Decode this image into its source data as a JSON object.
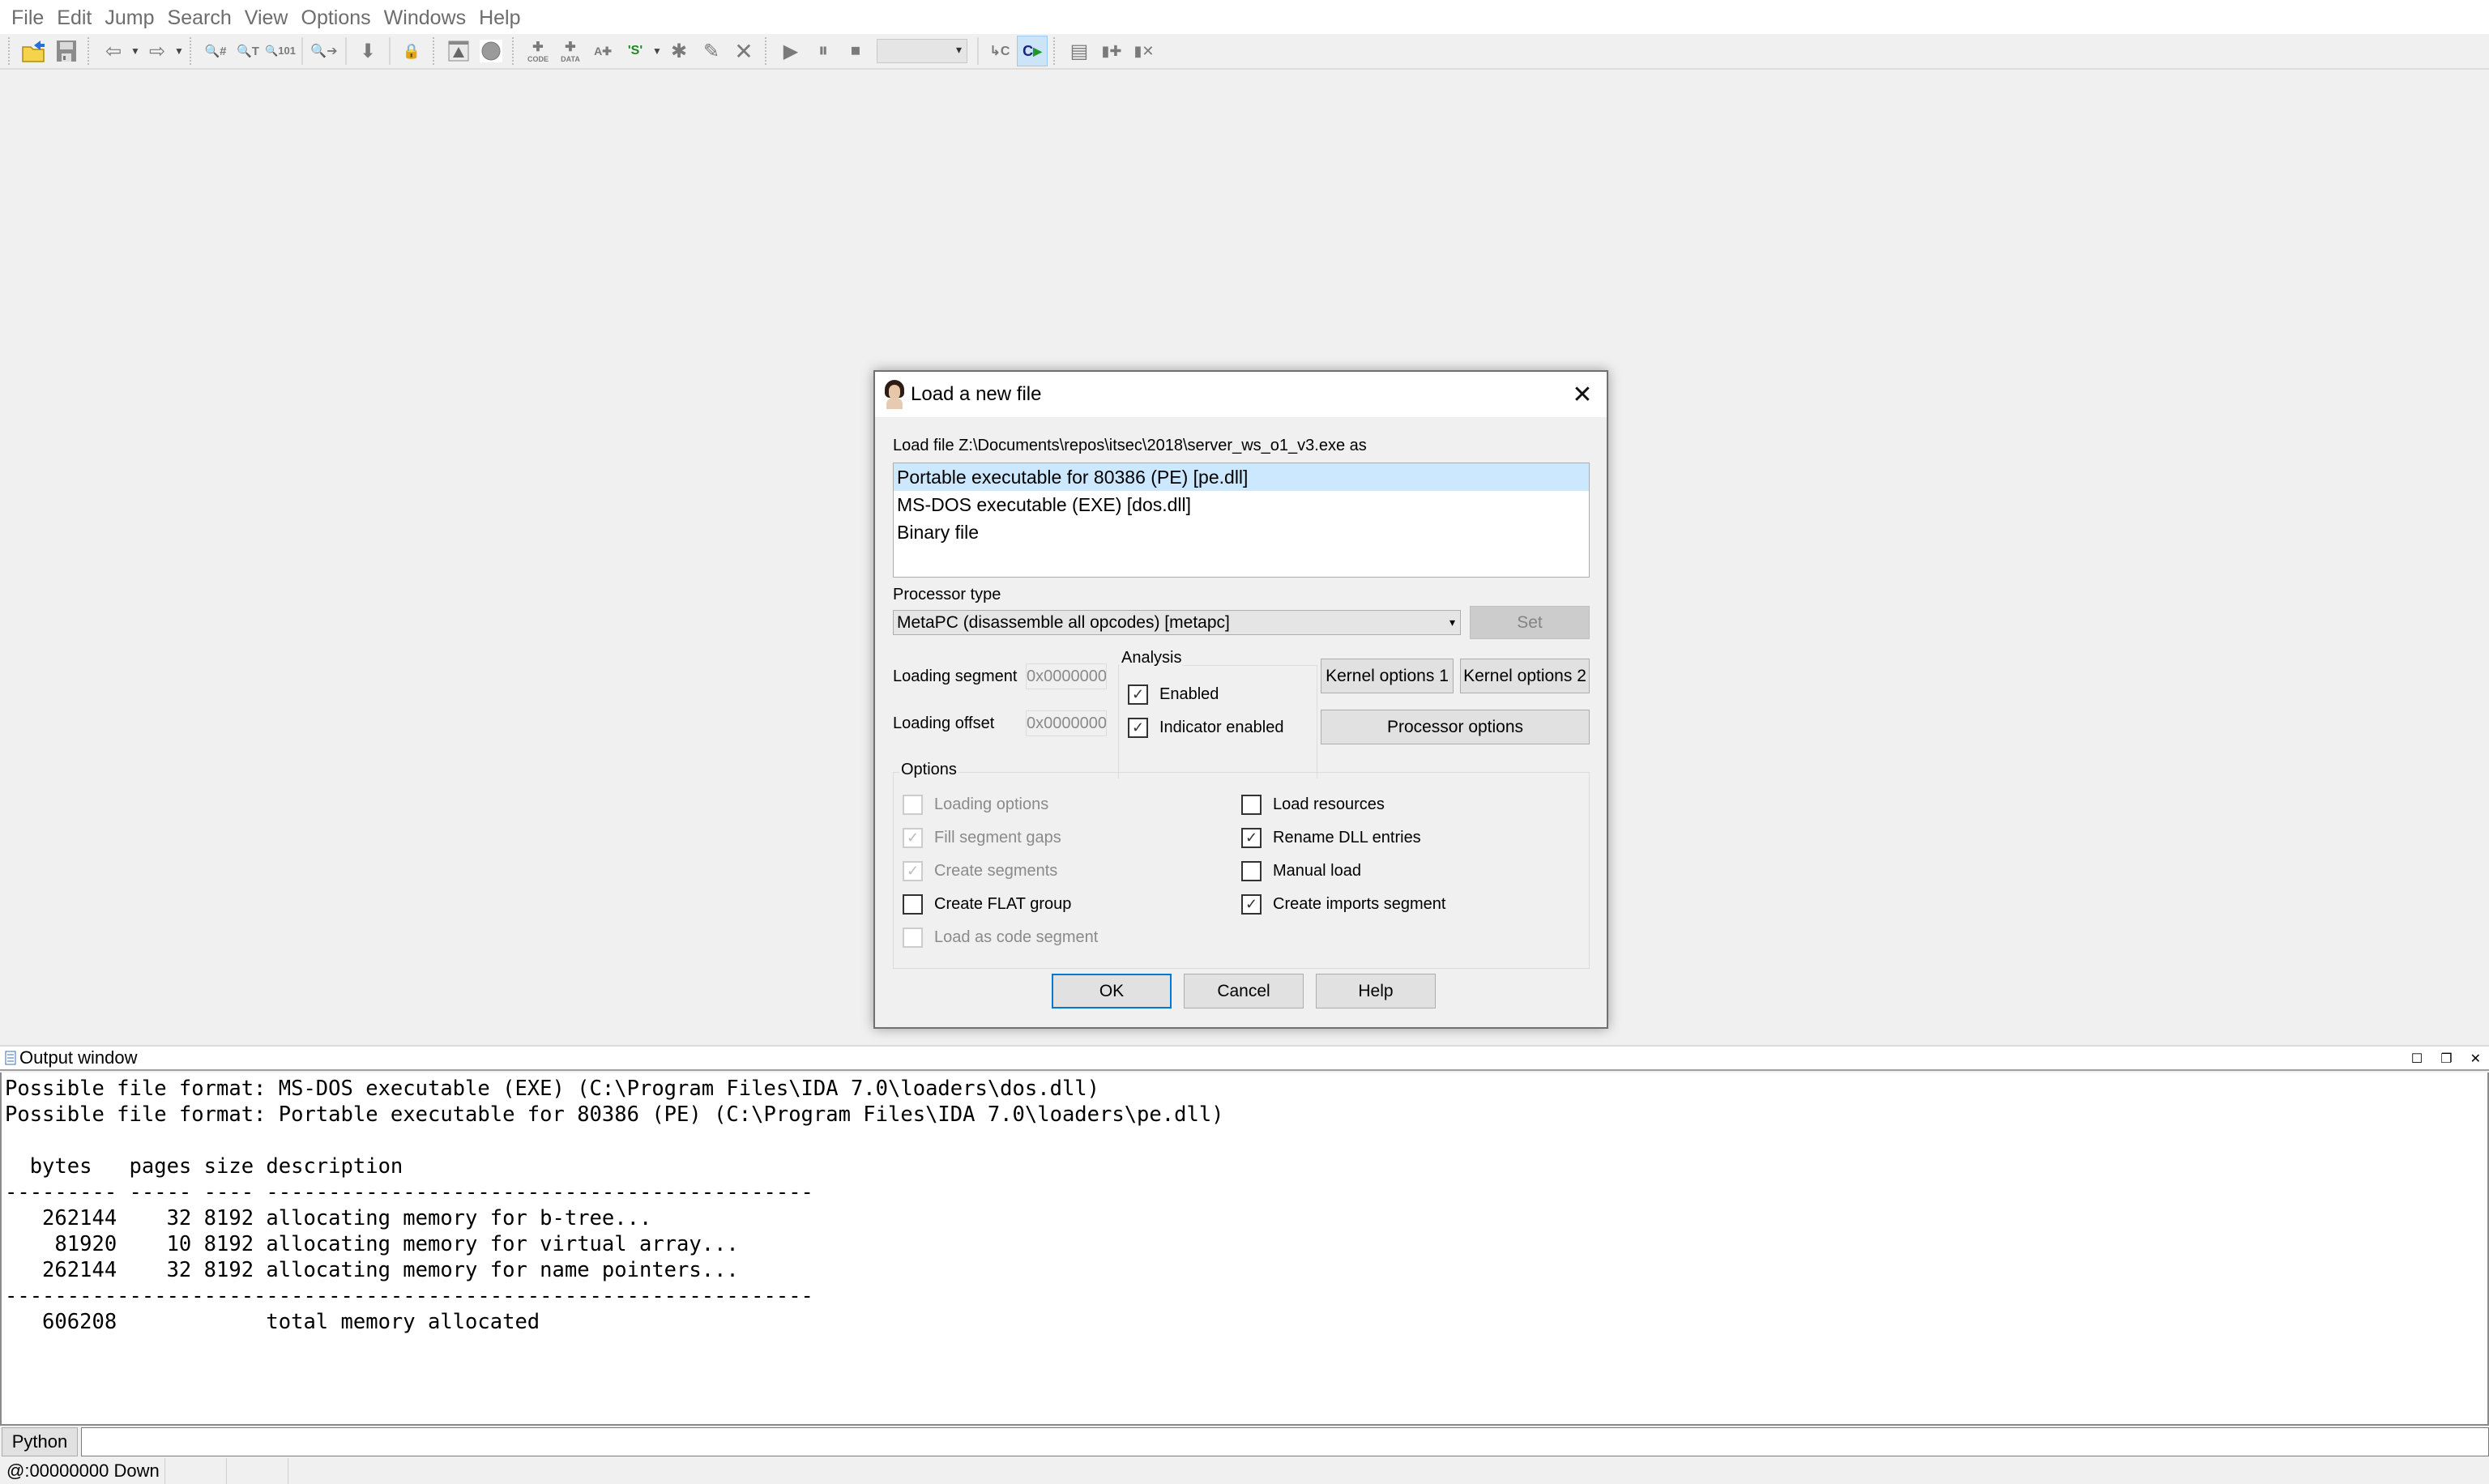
{
  "menu": [
    "File",
    "Edit",
    "Jump",
    "Search",
    "View",
    "Options",
    "Windows",
    "Help"
  ],
  "toolbar": {
    "groups": [
      [
        "open-file",
        "save-database"
      ],
      [
        "back",
        "forward"
      ],
      [
        "search-binary",
        "search-text",
        "search-immediate",
        "search-next",
        "jump-down",
        "lock"
      ],
      [
        "warning-window",
        "breakpoint-circle"
      ],
      [
        "create-code",
        "create-data",
        "create-ascii",
        "create-struct",
        "create-function",
        "edit-function",
        "undefine"
      ],
      [
        "run",
        "pause",
        "stop"
      ],
      [
        "step-into",
        "debugger-active"
      ],
      [
        "manage-segments",
        "add-segment",
        "delete-segment"
      ]
    ],
    "debugger_select_value": ""
  },
  "dialog": {
    "title": "Load a new file",
    "load_file_label": "Load file Z:\\Documents\\repos\\itsec\\2018\\server_ws_o1_v3.exe as",
    "file_types": [
      {
        "label": "Portable executable for 80386 (PE) [pe.dll]",
        "selected": true
      },
      {
        "label": "MS-DOS executable (EXE) [dos.dll]",
        "selected": false
      },
      {
        "label": "Binary file",
        "selected": false
      }
    ],
    "processor_type_label": "Processor type",
    "processor_type_value": "MetaPC (disassemble all opcodes) [metapc]",
    "set_button": "Set",
    "loading_segment_label": "Loading segment",
    "loading_segment_value": "0x00000000",
    "loading_offset_label": "Loading offset",
    "loading_offset_value": "0x00000000",
    "analysis": {
      "title": "Analysis",
      "enabled": {
        "label": "Enabled",
        "checked": true
      },
      "indicator_enabled": {
        "label": "Indicator enabled",
        "checked": true
      }
    },
    "kernel_options_1": "Kernel options 1",
    "kernel_options_2": "Kernel options 2",
    "processor_options": "Processor options",
    "options": {
      "title": "Options",
      "left": [
        {
          "label": "Loading options",
          "checked": false,
          "disabled": true
        },
        {
          "label": "Fill segment gaps",
          "checked": true,
          "disabled": true
        },
        {
          "label": "Create segments",
          "checked": true,
          "disabled": true
        },
        {
          "label": "Create FLAT group",
          "checked": false,
          "disabled": false
        },
        {
          "label": "Load as code segment",
          "checked": false,
          "disabled": true
        }
      ],
      "right": [
        {
          "label": "Load resources",
          "checked": false,
          "disabled": false
        },
        {
          "label": "Rename DLL entries",
          "checked": true,
          "disabled": false
        },
        {
          "label": "Manual load",
          "checked": false,
          "disabled": false
        },
        {
          "label": "Create imports segment",
          "checked": true,
          "disabled": false
        }
      ]
    },
    "ok": "OK",
    "cancel": "Cancel",
    "help": "Help"
  },
  "output_window": {
    "title": "Output window",
    "lines": [
      "Possible file format: MS-DOS executable (EXE) (C:\\Program Files\\IDA 7.0\\loaders\\dos.dll)",
      "Possible file format: Portable executable for 80386 (PE) (C:\\Program Files\\IDA 7.0\\loaders\\pe.dll)",
      "",
      "  bytes   pages size description",
      "--------- ----- ---- --------------------------------------------",
      "   262144    32 8192 allocating memory for b-tree...",
      "    81920    10 8192 allocating memory for virtual array...",
      "   262144    32 8192 allocating memory for name pointers...",
      "-----------------------------------------------------------------",
      "   606208            total memory allocated"
    ]
  },
  "python_button": "Python",
  "python_input_value": "",
  "status": {
    "address": "@:00000000",
    "direction": "Down"
  }
}
